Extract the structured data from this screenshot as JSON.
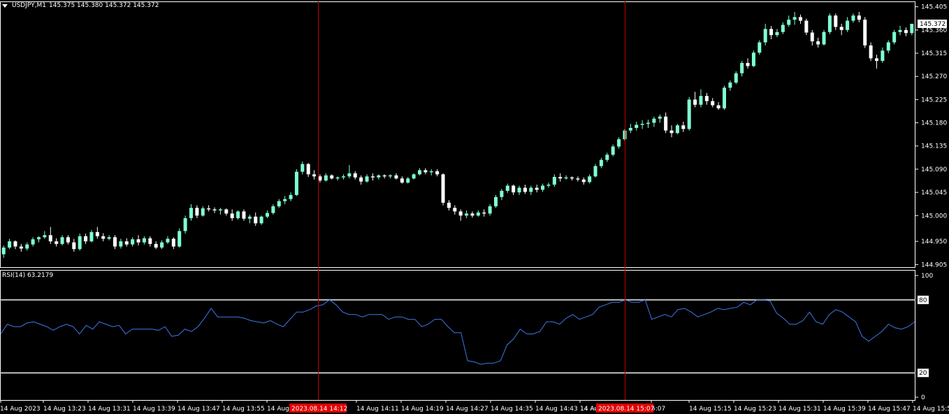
{
  "header": {
    "symbol": "USDJPY,M1",
    "ohlc": "145.375 145.380 145.372 145.372"
  },
  "price_axis": {
    "labels": [
      "145.405",
      "145.360",
      "145.315",
      "145.270",
      "145.225",
      "145.180",
      "145.135",
      "145.090",
      "145.045",
      "145.000",
      "144.950",
      "144.905"
    ],
    "current_price": "145.372"
  },
  "rsi": {
    "label": "RSI(14) 63.2179",
    "axis_labels": [
      "100",
      "80",
      "20",
      "0"
    ],
    "level_high_label": "80",
    "level_low_label": "20"
  },
  "time_axis": {
    "labels": [
      "14 Aug 2023",
      "14 Aug 13:23",
      "14 Aug 13:31",
      "14 Aug 13:39",
      "14 Aug 13:47",
      "14 Aug 13:55",
      "14 Aug",
      "14 Aug 14:11",
      "14 Aug 14:19",
      "14 Aug 14:27",
      "14 Aug 14:35",
      "14 Aug 14:43",
      "14 Aug 14:51",
      "14 Aug",
      "5:07",
      "14 Aug 15:15",
      "14 Aug 15:23",
      "14 Aug 15:31",
      "14 Aug 15:39",
      "14 Aug 15:47",
      "14 Aug 15:55"
    ],
    "crosshair_labels": [
      "2023.08.14 14:12",
      "2023.08.14 15:07"
    ]
  },
  "colors": {
    "background": "#000000",
    "bull_candle": "#7fffd4",
    "bear_candle": "#ffffff",
    "rsi_line": "#3c78e6",
    "level_line": "#c0c0c0",
    "crosshair": "#c00000",
    "crosshair_label_bg": "#e00000"
  },
  "chart_data": [
    {
      "type": "candlestick",
      "title": "USDJPY,M1",
      "ylim": [
        144.9,
        145.41
      ],
      "candles": [
        [
          144.925,
          144.942,
          144.918,
          144.938
        ],
        [
          144.938,
          144.955,
          144.935,
          144.95
        ],
        [
          144.95,
          144.952,
          144.935,
          144.94
        ],
        [
          144.94,
          144.945,
          144.93,
          144.936
        ],
        [
          144.936,
          144.948,
          144.932,
          144.944
        ],
        [
          144.944,
          144.958,
          144.94,
          144.954
        ],
        [
          144.954,
          144.96,
          144.948,
          144.958
        ],
        [
          144.958,
          144.97,
          144.955,
          144.962
        ],
        [
          144.962,
          144.978,
          144.945,
          144.95
        ],
        [
          144.95,
          144.956,
          144.94,
          144.945
        ],
        [
          144.945,
          144.962,
          144.942,
          144.958
        ],
        [
          144.958,
          144.962,
          144.944,
          144.948
        ],
        [
          144.948,
          144.955,
          144.93,
          144.935
        ],
        [
          144.935,
          144.965,
          144.932,
          144.96
        ],
        [
          144.96,
          144.965,
          144.945,
          144.95
        ],
        [
          144.95,
          144.972,
          144.948,
          144.968
        ],
        [
          144.968,
          144.978,
          144.955,
          144.96
        ],
        [
          144.96,
          144.966,
          144.95,
          144.955
        ],
        [
          144.955,
          144.962,
          144.952,
          144.958
        ],
        [
          144.958,
          144.962,
          144.935,
          144.94
        ],
        [
          144.94,
          144.955,
          144.936,
          144.95
        ],
        [
          144.95,
          144.956,
          144.94,
          144.944
        ],
        [
          144.944,
          144.958,
          144.94,
          144.954
        ],
        [
          144.954,
          144.962,
          144.942,
          144.948
        ],
        [
          144.948,
          144.96,
          144.944,
          144.956
        ],
        [
          144.956,
          144.96,
          144.94,
          144.945
        ],
        [
          144.945,
          144.95,
          144.935,
          144.938
        ],
        [
          144.938,
          144.952,
          144.935,
          144.948
        ],
        [
          144.948,
          144.96,
          144.945,
          144.955
        ],
        [
          144.955,
          144.958,
          144.935,
          144.94
        ],
        [
          144.94,
          144.975,
          144.938,
          144.97
        ],
        [
          144.97,
          145.0,
          144.965,
          144.995
        ],
        [
          144.995,
          145.022,
          144.99,
          145.015
        ],
        [
          145.015,
          145.02,
          144.995,
          145.0
        ],
        [
          145.0,
          145.018,
          144.998,
          145.014
        ],
        [
          145.014,
          145.02,
          145.008,
          145.012
        ],
        [
          145.012,
          145.016,
          145.005,
          145.01
        ],
        [
          145.01,
          145.015,
          145.002,
          145.012
        ],
        [
          145.012,
          145.014,
          145.0,
          145.004
        ],
        [
          145.004,
          145.012,
          144.99,
          144.995
        ],
        [
          144.995,
          145.01,
          144.992,
          145.008
        ],
        [
          145.008,
          145.012,
          144.99,
          144.994
        ],
        [
          144.994,
          145.002,
          144.985,
          144.998
        ],
        [
          144.998,
          145.006,
          144.98,
          144.985
        ],
        [
          144.985,
          145.0,
          144.982,
          144.998
        ],
        [
          144.998,
          145.01,
          144.995,
          145.005
        ],
        [
          145.005,
          145.022,
          145.002,
          145.018
        ],
        [
          145.018,
          145.032,
          145.015,
          145.028
        ],
        [
          145.028,
          145.038,
          145.022,
          145.032
        ],
        [
          145.032,
          145.045,
          145.028,
          145.04
        ],
        [
          145.04,
          145.09,
          145.038,
          145.085
        ],
        [
          145.085,
          145.105,
          145.08,
          145.1
        ],
        [
          145.1,
          145.102,
          145.075,
          145.08
        ],
        [
          145.08,
          145.088,
          145.07,
          145.076
        ],
        [
          145.076,
          145.08,
          145.064,
          145.068
        ],
        [
          145.068,
          145.082,
          145.066,
          145.078
        ],
        [
          145.078,
          145.08,
          145.07,
          145.072
        ],
        [
          145.072,
          145.076,
          145.068,
          145.074
        ],
        [
          145.074,
          145.08,
          145.07,
          145.076
        ],
        [
          145.076,
          145.098,
          145.072,
          145.082
        ],
        [
          145.082,
          145.086,
          145.07,
          145.074
        ],
        [
          145.074,
          145.078,
          145.06,
          145.066
        ],
        [
          145.066,
          145.08,
          145.064,
          145.076
        ],
        [
          145.076,
          145.082,
          145.068,
          145.074
        ],
        [
          145.074,
          145.08,
          145.07,
          145.078
        ],
        [
          145.078,
          145.08,
          145.072,
          145.076
        ],
        [
          145.076,
          145.08,
          145.072,
          145.078
        ],
        [
          145.078,
          145.082,
          145.07,
          145.072
        ],
        [
          145.072,
          145.076,
          145.062,
          145.064
        ],
        [
          145.064,
          145.075,
          145.062,
          145.072
        ],
        [
          145.072,
          145.082,
          145.07,
          145.08
        ],
        [
          145.08,
          145.092,
          145.078,
          145.088
        ],
        [
          145.088,
          145.092,
          145.08,
          145.084
        ],
        [
          145.084,
          145.09,
          145.078,
          145.086
        ],
        [
          145.086,
          145.09,
          145.076,
          145.08
        ],
        [
          145.08,
          145.082,
          145.02,
          145.025
        ],
        [
          145.025,
          145.03,
          145.01,
          145.015
        ],
        [
          145.015,
          145.02,
          145.002,
          145.008
        ],
        [
          145.008,
          145.012,
          144.99,
          145.0
        ],
        [
          145.0,
          145.01,
          144.995,
          145.004
        ],
        [
          145.004,
          145.008,
          144.996,
          145.0
        ],
        [
          145.0,
          145.01,
          144.998,
          145.006
        ],
        [
          145.006,
          145.012,
          144.998,
          145.004
        ],
        [
          145.004,
          145.022,
          145.0,
          145.018
        ],
        [
          145.018,
          145.04,
          145.015,
          145.036
        ],
        [
          145.036,
          145.052,
          145.03,
          145.048
        ],
        [
          145.048,
          145.062,
          145.044,
          145.058
        ],
        [
          145.058,
          145.06,
          145.04,
          145.045
        ],
        [
          145.045,
          145.058,
          145.04,
          145.054
        ],
        [
          145.054,
          145.06,
          145.042,
          145.046
        ],
        [
          145.046,
          145.058,
          145.04,
          145.054
        ],
        [
          145.054,
          145.06,
          145.045,
          145.05
        ],
        [
          145.05,
          145.062,
          145.046,
          145.058
        ],
        [
          145.058,
          145.064,
          145.054,
          145.06
        ],
        [
          145.06,
          145.08,
          145.056,
          145.075
        ],
        [
          145.075,
          145.082,
          145.066,
          145.072
        ],
        [
          145.072,
          145.078,
          145.07,
          145.074
        ],
        [
          145.074,
          145.076,
          145.068,
          145.072
        ],
        [
          145.072,
          145.076,
          145.066,
          145.07
        ],
        [
          145.07,
          145.074,
          145.06,
          145.065
        ],
        [
          145.065,
          145.08,
          145.062,
          145.076
        ],
        [
          145.076,
          145.1,
          145.074,
          145.096
        ],
        [
          145.096,
          145.112,
          145.092,
          145.108
        ],
        [
          145.108,
          145.122,
          145.104,
          145.118
        ],
        [
          145.118,
          145.138,
          145.115,
          145.134
        ],
        [
          145.134,
          145.152,
          145.13,
          145.148
        ],
        [
          145.148,
          145.168,
          145.145,
          145.165
        ],
        [
          145.165,
          145.178,
          145.16,
          145.17
        ],
        [
          145.17,
          145.182,
          145.165,
          145.176
        ],
        [
          145.176,
          145.185,
          145.168,
          145.178
        ],
        [
          145.178,
          145.186,
          145.17,
          145.18
        ],
        [
          145.18,
          145.192,
          145.172,
          145.188
        ],
        [
          145.188,
          145.196,
          145.18,
          145.192
        ],
        [
          145.192,
          145.2,
          145.16,
          145.165
        ],
        [
          145.165,
          145.175,
          145.152,
          145.16
        ],
        [
          145.16,
          145.178,
          145.158,
          145.175
        ],
        [
          145.175,
          145.182,
          145.162,
          145.168
        ],
        [
          145.168,
          145.23,
          145.165,
          145.225
        ],
        [
          145.225,
          145.24,
          145.21,
          145.215
        ],
        [
          145.215,
          145.245,
          145.21,
          145.232
        ],
        [
          145.232,
          145.238,
          145.215,
          145.222
        ],
        [
          145.222,
          145.228,
          145.21,
          145.214
        ],
        [
          145.214,
          145.22,
          145.205,
          145.208
        ],
        [
          145.208,
          145.252,
          145.205,
          145.248
        ],
        [
          145.248,
          145.262,
          145.242,
          145.258
        ],
        [
          145.258,
          145.28,
          145.255,
          145.276
        ],
        [
          145.276,
          145.3,
          145.27,
          145.296
        ],
        [
          145.296,
          145.305,
          145.285,
          145.29
        ],
        [
          145.29,
          145.32,
          145.288,
          145.316
        ],
        [
          145.316,
          145.34,
          145.312,
          145.336
        ],
        [
          145.336,
          145.372,
          145.33,
          145.362
        ],
        [
          145.362,
          145.368,
          145.342,
          145.35
        ],
        [
          145.35,
          145.362,
          145.346,
          145.356
        ],
        [
          145.356,
          145.375,
          145.352,
          145.37
        ],
        [
          145.37,
          145.388,
          145.366,
          145.38
        ],
        [
          145.38,
          145.395,
          145.37,
          145.385
        ],
        [
          145.385,
          145.39,
          145.372,
          145.378
        ],
        [
          145.378,
          145.382,
          145.35,
          145.355
        ],
        [
          145.355,
          145.36,
          145.33,
          145.338
        ],
        [
          145.338,
          145.345,
          145.326,
          145.332
        ],
        [
          145.332,
          145.36,
          145.33,
          145.356
        ],
        [
          145.356,
          145.392,
          145.352,
          145.388
        ],
        [
          145.388,
          145.392,
          145.36,
          145.366
        ],
        [
          145.366,
          145.372,
          145.35,
          145.36
        ],
        [
          145.36,
          145.385,
          145.356,
          145.378
        ],
        [
          145.378,
          145.392,
          145.374,
          145.388
        ],
        [
          145.388,
          145.395,
          145.375,
          145.38
        ],
        [
          145.38,
          145.385,
          145.325,
          145.33
        ],
        [
          145.33,
          145.336,
          145.3,
          145.305
        ],
        [
          145.305,
          145.312,
          145.285,
          145.3
        ],
        [
          145.3,
          145.326,
          145.296,
          145.32
        ],
        [
          145.32,
          145.34,
          145.315,
          145.336
        ],
        [
          145.336,
          145.36,
          145.332,
          145.356
        ],
        [
          145.356,
          145.368,
          145.35,
          145.36
        ],
        [
          145.36,
          145.365,
          145.348,
          145.354
        ],
        [
          145.354,
          145.372,
          145.35,
          145.372
        ]
      ]
    },
    {
      "type": "line",
      "title": "RSI(14) 63.2179",
      "ylim": [
        0,
        100
      ],
      "levels": [
        20,
        80
      ],
      "values": [
        52,
        60,
        58,
        58,
        61,
        62,
        60,
        58,
        55,
        58,
        60,
        58,
        52,
        59,
        56,
        62,
        60,
        58,
        59,
        52,
        56,
        56,
        56,
        56,
        55,
        58,
        50,
        51,
        56,
        54,
        58,
        65,
        73,
        66,
        66,
        66,
        66,
        65,
        63,
        62,
        61,
        63,
        60,
        58,
        64,
        70,
        70,
        72,
        75,
        76,
        80,
        76,
        70,
        68,
        68,
        66,
        68,
        68,
        68,
        64,
        66,
        66,
        64,
        64,
        58,
        60,
        64,
        64,
        58,
        53,
        53,
        30,
        29,
        27,
        28,
        28,
        30,
        43,
        48,
        56,
        52,
        52,
        54,
        62,
        62,
        60,
        65,
        68,
        64,
        66,
        68,
        74,
        76,
        78,
        78,
        80,
        78,
        78,
        80,
        64,
        66,
        68,
        66,
        72,
        73,
        70,
        66,
        68,
        70,
        73,
        72,
        73,
        74,
        78,
        76,
        80,
        80,
        79,
        69,
        65,
        60,
        60,
        63,
        70,
        62,
        60,
        68,
        72,
        70,
        66,
        62,
        50,
        46,
        50,
        54,
        60,
        57,
        56,
        58,
        62
      ]
    }
  ]
}
